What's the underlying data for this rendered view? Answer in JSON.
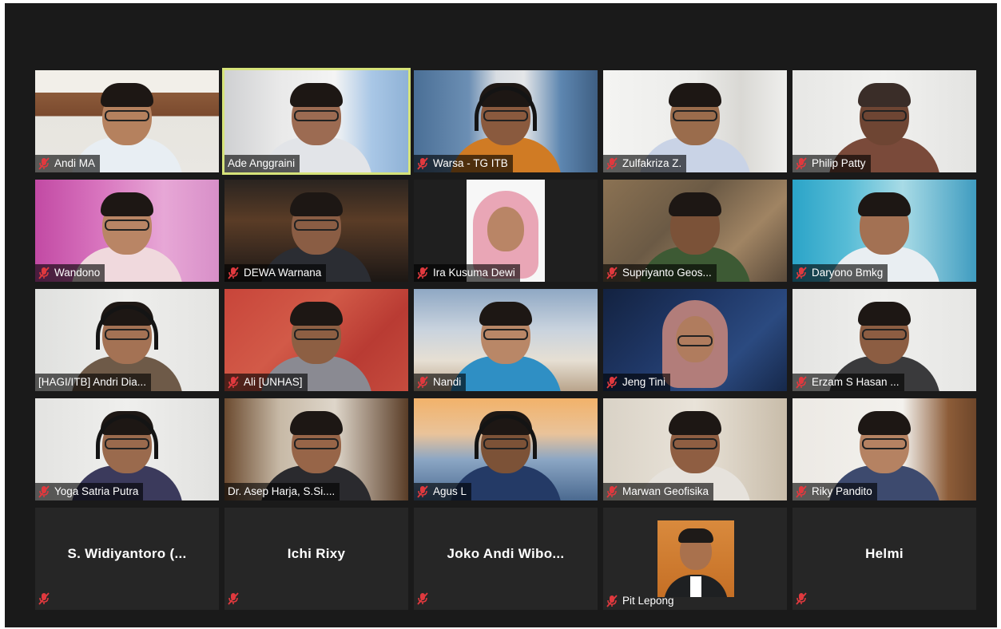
{
  "participants": [
    {
      "name": "Andi MA",
      "muted": true,
      "active": false,
      "video": true
    },
    {
      "name": "Ade Anggraini",
      "muted": false,
      "active": true,
      "video": true
    },
    {
      "name": "Warsa - TG ITB",
      "muted": true,
      "active": false,
      "video": true
    },
    {
      "name": "Zulfakriza Z.",
      "muted": true,
      "active": false,
      "video": true
    },
    {
      "name": "Philip Patty",
      "muted": true,
      "active": false,
      "video": true
    },
    {
      "name": "Wandono",
      "muted": true,
      "active": false,
      "video": true
    },
    {
      "name": "DEWA Warnana",
      "muted": true,
      "active": false,
      "video": true
    },
    {
      "name": "Ira Kusuma Dewi",
      "muted": true,
      "active": false,
      "video": true
    },
    {
      "name": "Supriyanto Geos...",
      "muted": true,
      "active": false,
      "video": true
    },
    {
      "name": "Daryono Bmkg",
      "muted": true,
      "active": false,
      "video": true
    },
    {
      "name": "[HAGI/ITB] Andri Dia...",
      "muted": false,
      "active": false,
      "video": true
    },
    {
      "name": "Ali [UNHAS]",
      "muted": true,
      "active": false,
      "video": true
    },
    {
      "name": "Nandi",
      "muted": true,
      "active": false,
      "video": true
    },
    {
      "name": "Jeng Tini",
      "muted": true,
      "active": false,
      "video": true
    },
    {
      "name": "Erzam S Hasan ...",
      "muted": true,
      "active": false,
      "video": true
    },
    {
      "name": "Yoga Satria Putra",
      "muted": true,
      "active": false,
      "video": true
    },
    {
      "name": "Dr. Asep Harja, S.Si....",
      "muted": false,
      "active": false,
      "video": true
    },
    {
      "name": "Agus L",
      "muted": true,
      "active": false,
      "video": true
    },
    {
      "name": "Marwan Geofisika",
      "muted": true,
      "active": false,
      "video": true
    },
    {
      "name": "Riky Pandito",
      "muted": true,
      "active": false,
      "video": true
    },
    {
      "name": "S. Widiyantoro (...",
      "muted": true,
      "active": false,
      "video": false
    },
    {
      "name": "Ichi Rixy",
      "muted": true,
      "active": false,
      "video": false
    },
    {
      "name": "Joko Andi Wibo...",
      "muted": true,
      "active": false,
      "video": false
    },
    {
      "name": "Pit Lepong",
      "muted": true,
      "active": false,
      "video": false,
      "avatar": true
    },
    {
      "name": "Helmi",
      "muted": true,
      "active": false,
      "video": false
    }
  ],
  "colors": {
    "background": "#1a1a1a",
    "tile": "#262626",
    "active_border": "#d6e37a",
    "muted_icon": "#e0393e"
  },
  "icons": {
    "muted": "microphone-muted-icon"
  }
}
